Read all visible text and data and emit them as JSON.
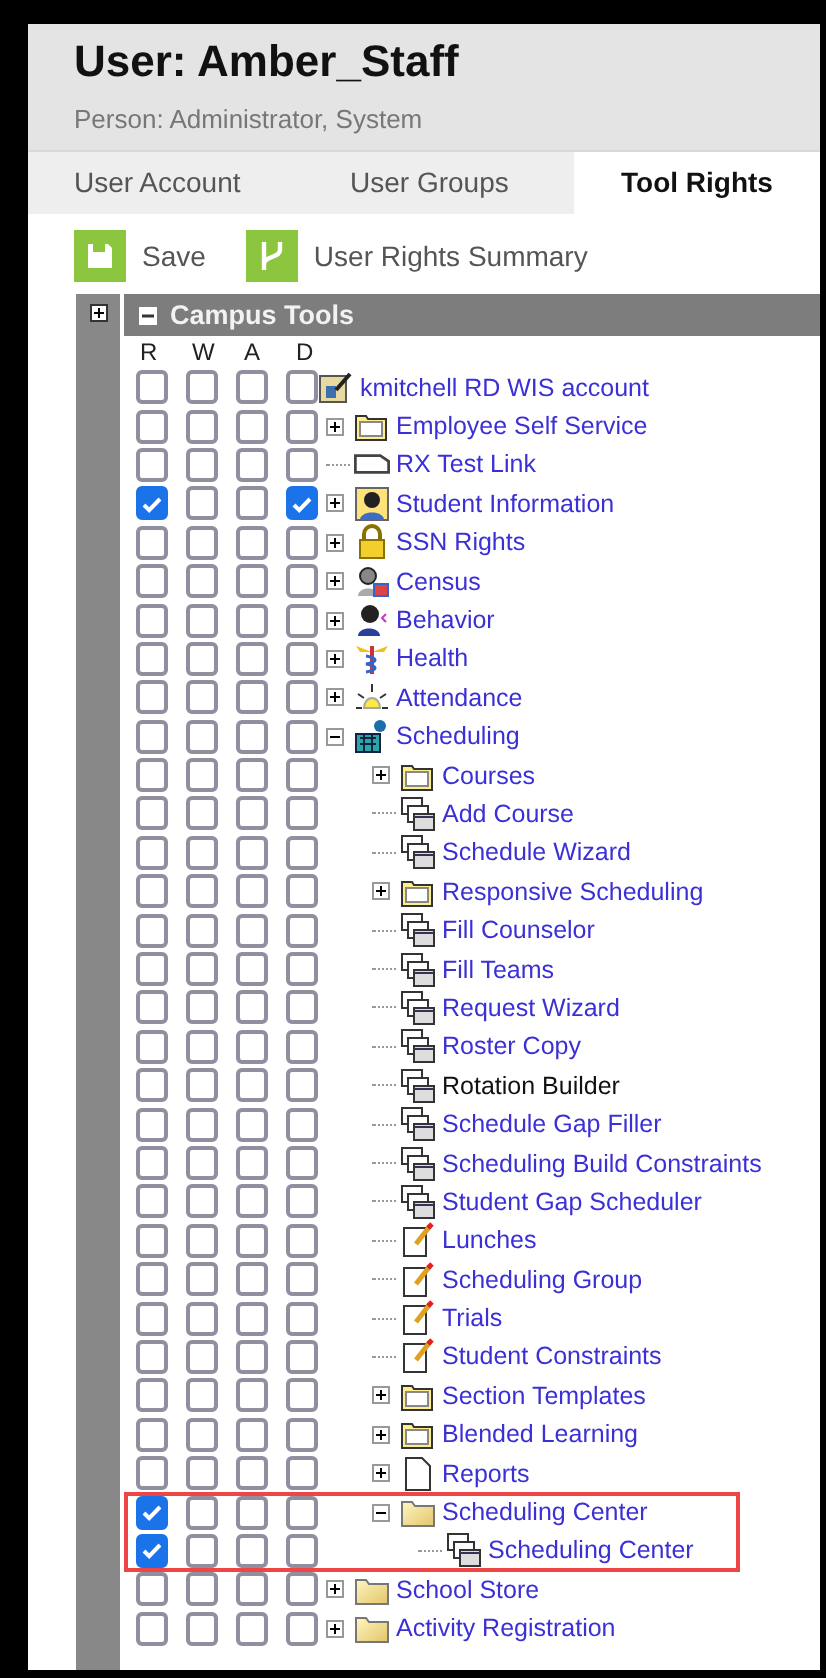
{
  "header": {
    "title": "User: Amber_Staff",
    "subtitle": "Person: Administrator, System"
  },
  "tabs": [
    {
      "label": "User Account",
      "selected": false
    },
    {
      "label": "User Groups",
      "selected": false
    },
    {
      "label": "Tool Rights",
      "selected": true
    }
  ],
  "toolbar": [
    {
      "label": "Save",
      "kind": "save"
    },
    {
      "label": "User Rights Summary",
      "kind": "summary"
    }
  ],
  "panel": {
    "title": "Campus Tools",
    "expanded": true,
    "columns": [
      "R",
      "W",
      "A",
      "D"
    ]
  },
  "tree": [
    {
      "label": "kmitchell RD WIS account",
      "kind": "account",
      "linked": true,
      "highlighted": false,
      "rights": [
        false,
        false,
        false,
        false
      ],
      "children": [
        {
          "label": "Employee Self Service",
          "kind": "folder",
          "expanded": false,
          "linked": true,
          "highlighted": false,
          "rights": [
            false,
            false,
            false,
            false
          ]
        },
        {
          "label": "RX Test Link",
          "kind": "link",
          "linked": true,
          "highlighted": false,
          "rights": [
            false,
            false,
            false,
            false
          ]
        },
        {
          "label": "Student Information",
          "kind": "person",
          "expanded": false,
          "linked": true,
          "highlighted": false,
          "rights": [
            true,
            false,
            false,
            true
          ]
        },
        {
          "label": "SSN Rights",
          "kind": "lock",
          "expanded": false,
          "linked": true,
          "highlighted": false,
          "rights": [
            false,
            false,
            false,
            false
          ]
        },
        {
          "label": "Census",
          "kind": "census",
          "expanded": false,
          "linked": true,
          "highlighted": false,
          "rights": [
            false,
            false,
            false,
            false
          ]
        },
        {
          "label": "Behavior",
          "kind": "behavior",
          "expanded": false,
          "linked": true,
          "highlighted": false,
          "rights": [
            false,
            false,
            false,
            false
          ]
        },
        {
          "label": "Health",
          "kind": "health",
          "expanded": false,
          "linked": true,
          "highlighted": false,
          "rights": [
            false,
            false,
            false,
            false
          ]
        },
        {
          "label": "Attendance",
          "kind": "attendance",
          "expanded": false,
          "linked": true,
          "highlighted": false,
          "rights": [
            false,
            false,
            false,
            false
          ]
        },
        {
          "label": "Scheduling",
          "kind": "scheduling",
          "expanded": true,
          "linked": true,
          "highlighted": false,
          "rights": [
            false,
            false,
            false,
            false
          ],
          "children": [
            {
              "label": "Courses",
              "kind": "folder",
              "expanded": false,
              "linked": true,
              "highlighted": false,
              "rights": [
                false,
                false,
                false,
                false
              ]
            },
            {
              "label": "Add Course",
              "kind": "windows",
              "linked": true,
              "highlighted": false,
              "rights": [
                false,
                false,
                false,
                false
              ]
            },
            {
              "label": "Schedule Wizard",
              "kind": "windows",
              "linked": true,
              "highlighted": false,
              "rights": [
                false,
                false,
                false,
                false
              ]
            },
            {
              "label": "Responsive Scheduling",
              "kind": "folder",
              "expanded": false,
              "linked": true,
              "highlighted": false,
              "rights": [
                false,
                false,
                false,
                false
              ]
            },
            {
              "label": "Fill Counselor",
              "kind": "windows",
              "linked": true,
              "highlighted": false,
              "rights": [
                false,
                false,
                false,
                false
              ]
            },
            {
              "label": "Fill Teams",
              "kind": "windows",
              "linked": true,
              "highlighted": false,
              "rights": [
                false,
                false,
                false,
                false
              ]
            },
            {
              "label": "Request Wizard",
              "kind": "windows",
              "linked": true,
              "highlighted": false,
              "rights": [
                false,
                false,
                false,
                false
              ]
            },
            {
              "label": "Roster Copy",
              "kind": "windows",
              "linked": true,
              "highlighted": false,
              "rights": [
                false,
                false,
                false,
                false
              ]
            },
            {
              "label": "Rotation Builder",
              "kind": "windows",
              "linked": false,
              "highlighted": false,
              "rights": [
                false,
                false,
                false,
                false
              ]
            },
            {
              "label": "Schedule Gap Filler",
              "kind": "windows",
              "linked": true,
              "highlighted": false,
              "rights": [
                false,
                false,
                false,
                false
              ]
            },
            {
              "label": "Scheduling Build Constraints",
              "kind": "windows",
              "linked": true,
              "highlighted": false,
              "rights": [
                false,
                false,
                false,
                false
              ]
            },
            {
              "label": "Student Gap Scheduler",
              "kind": "windows",
              "linked": true,
              "highlighted": false,
              "rights": [
                false,
                false,
                false,
                false
              ]
            },
            {
              "label": "Lunches",
              "kind": "notepad",
              "linked": true,
              "highlighted": false,
              "rights": [
                false,
                false,
                false,
                false
              ]
            },
            {
              "label": "Scheduling Group",
              "kind": "notepad",
              "linked": true,
              "highlighted": false,
              "rights": [
                false,
                false,
                false,
                false
              ]
            },
            {
              "label": "Trials",
              "kind": "notepad",
              "linked": true,
              "highlighted": false,
              "rights": [
                false,
                false,
                false,
                false
              ]
            },
            {
              "label": "Student Constraints",
              "kind": "notepad",
              "linked": true,
              "highlighted": false,
              "rights": [
                false,
                false,
                false,
                false
              ]
            },
            {
              "label": "Section Templates",
              "kind": "folder",
              "expanded": false,
              "linked": true,
              "highlighted": false,
              "rights": [
                false,
                false,
                false,
                false
              ]
            },
            {
              "label": "Blended Learning",
              "kind": "folder",
              "expanded": false,
              "linked": true,
              "highlighted": false,
              "rights": [
                false,
                false,
                false,
                false
              ]
            },
            {
              "label": "Reports",
              "kind": "page",
              "expanded": false,
              "linked": true,
              "highlighted": false,
              "rights": [
                false,
                false,
                false,
                false
              ]
            },
            {
              "label": "Scheduling Center",
              "kind": "shaded-folder",
              "expanded": true,
              "linked": true,
              "highlighted": true,
              "rights": [
                true,
                false,
                false,
                false
              ],
              "children": [
                {
                  "label": "Scheduling Center",
                  "kind": "windows",
                  "linked": true,
                  "highlighted": true,
                  "rights": [
                    true,
                    false,
                    false,
                    false
                  ]
                }
              ]
            }
          ]
        },
        {
          "label": "School Store",
          "kind": "shaded-folder",
          "expanded": false,
          "linked": true,
          "highlighted": false,
          "rights": [
            false,
            false,
            false,
            false
          ]
        },
        {
          "label": "Activity Registration",
          "kind": "shaded-folder",
          "expanded": false,
          "linked": true,
          "highlighted": false,
          "rights": [
            false,
            false,
            false,
            false
          ]
        }
      ]
    }
  ]
}
